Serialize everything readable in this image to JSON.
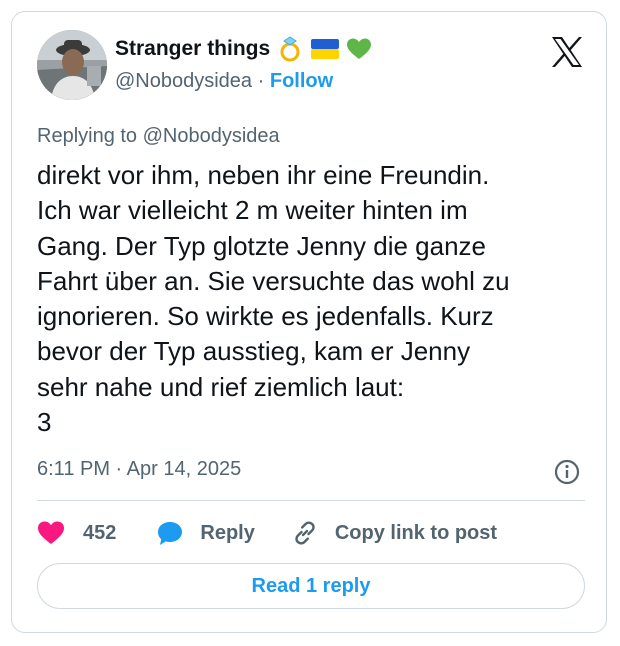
{
  "author": {
    "display_name": "Stranger things",
    "emoji": [
      "ring-emoji",
      "ukraine-flag-emoji",
      "green-heart-emoji"
    ],
    "handle": "@Nobodysidea",
    "separator": "·",
    "follow_label": "Follow",
    "avatar_icon": "profile-photo"
  },
  "platform_logo": "x-logo",
  "replying_to": "Replying to @Nobodysidea",
  "body": "direkt vor ihm, neben ihr eine Freundin.\nIch war vielleicht 2 m weiter hinten im\nGang. Der Typ glotzte Jenny die ganze\nFahrt über an. Sie versuchte das wohl zu\nignorieren. So wirkte es jedenfalls. Kurz\nbevor der Typ ausstieg, kam er Jenny\nsehr nahe und rief ziemlich laut:\n3",
  "timestamp": "6:11 PM · Apr 14, 2025",
  "actions": {
    "like_count": "452",
    "reply_label": "Reply",
    "copy_link_label": "Copy link to post"
  },
  "read_reply_label": "Read 1 reply",
  "colors": {
    "accent": "#1d9bf0",
    "like": "#f91880",
    "text": "#0f1419",
    "secondary": "#536471",
    "border": "#cfd9de"
  }
}
